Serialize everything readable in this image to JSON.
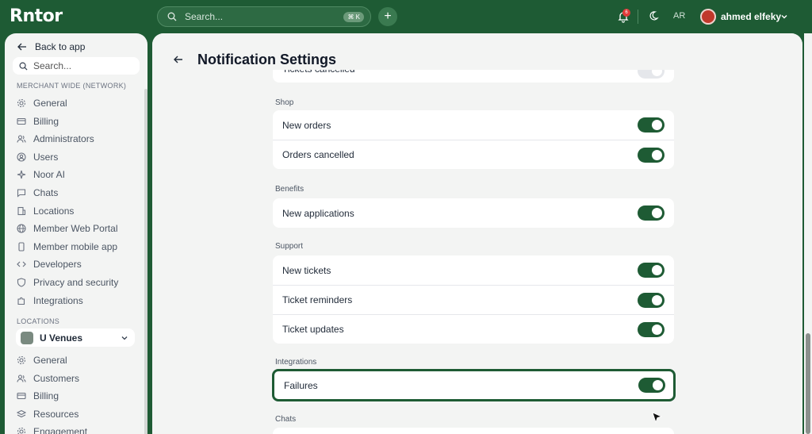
{
  "header": {
    "logo": "Rntor",
    "search_placeholder": "Search...",
    "shortcut": "⌘ K",
    "notification_count": "6",
    "language": "AR",
    "user_name": "ahmed elfeky"
  },
  "sidebar": {
    "back_label": "Back to app",
    "search_placeholder": "Search...",
    "merchant_section": "MERCHANT WIDE (NETWORK)",
    "merchant_items": [
      {
        "label": "General",
        "icon": "gear-icon"
      },
      {
        "label": "Billing",
        "icon": "card-icon"
      },
      {
        "label": "Administrators",
        "icon": "users-icon"
      },
      {
        "label": "Users",
        "icon": "user-circle-icon"
      },
      {
        "label": "Noor AI",
        "icon": "sparkle-icon"
      },
      {
        "label": "Chats",
        "icon": "chat-icon"
      },
      {
        "label": "Locations",
        "icon": "building-icon"
      },
      {
        "label": "Member Web Portal",
        "icon": "globe-icon"
      },
      {
        "label": "Member mobile app",
        "icon": "phone-icon"
      },
      {
        "label": "Developers",
        "icon": "code-icon"
      },
      {
        "label": "Privacy and security",
        "icon": "shield-icon"
      },
      {
        "label": "Integrations",
        "icon": "puzzle-icon"
      }
    ],
    "locations_section": "LOCATIONS",
    "location_selected": "U Venues",
    "location_items": [
      {
        "label": "General",
        "icon": "gear-icon"
      },
      {
        "label": "Customers",
        "icon": "users-icon"
      },
      {
        "label": "Billing",
        "icon": "card-icon"
      },
      {
        "label": "Resources",
        "icon": "layers-icon"
      },
      {
        "label": "Engagement",
        "icon": "gear-icon"
      }
    ]
  },
  "main": {
    "title": "Notification Settings",
    "top_partial_row": "Tickets cancelled",
    "groups": [
      {
        "label": "Shop",
        "rows": [
          {
            "label": "New orders",
            "on": true
          },
          {
            "label": "Orders cancelled",
            "on": true
          }
        ]
      },
      {
        "label": "Benefits",
        "rows": [
          {
            "label": "New applications",
            "on": true
          }
        ]
      },
      {
        "label": "Support",
        "rows": [
          {
            "label": "New tickets",
            "on": true
          },
          {
            "label": "Ticket reminders",
            "on": true
          },
          {
            "label": "Ticket updates",
            "on": true
          }
        ]
      },
      {
        "label": "Integrations",
        "rows": [
          {
            "label": "Failures",
            "on": true
          }
        ]
      },
      {
        "label": "Chats",
        "rows": []
      }
    ]
  },
  "colors": {
    "brand": "#1e5b34",
    "toggle_on": "#1e5b34",
    "badge": "#e23b3b"
  }
}
